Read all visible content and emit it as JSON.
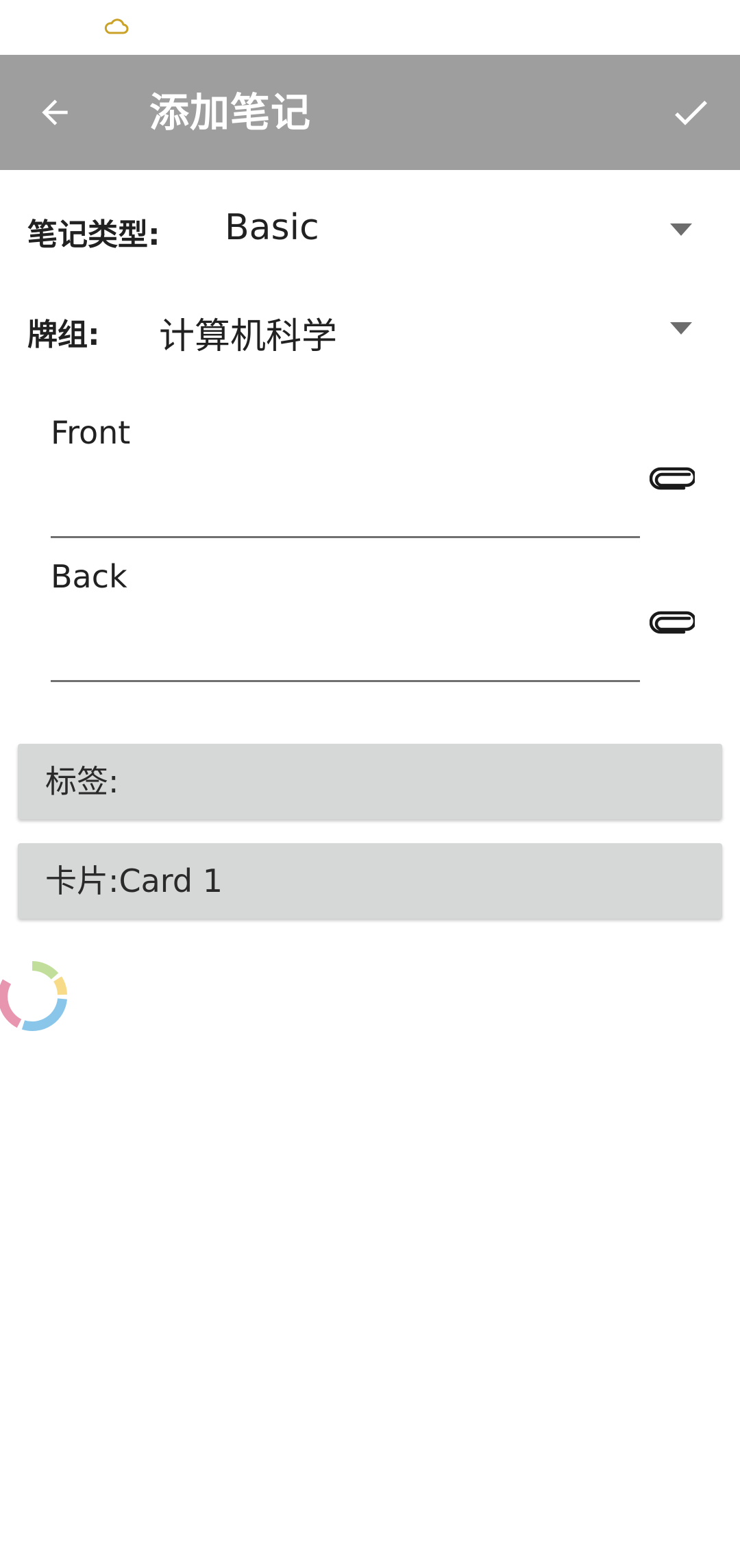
{
  "app_bar": {
    "title": "添加笔记",
    "icons": {
      "back": "arrow-back-icon",
      "save": "check-icon"
    }
  },
  "note_type": {
    "label": "笔记类型:",
    "value": "Basic"
  },
  "deck": {
    "label": "牌组:",
    "value": "计算机科学"
  },
  "fields": [
    {
      "label": "Front",
      "value": ""
    },
    {
      "label": "Back",
      "value": ""
    }
  ],
  "tags_button": {
    "label": "标签:"
  },
  "cards_button": {
    "label": "卡片:Card 1"
  },
  "colors": {
    "app_bar": "#9e9e9e",
    "button_bg": "#d6d7d7",
    "status_icon": "#c9a227"
  }
}
